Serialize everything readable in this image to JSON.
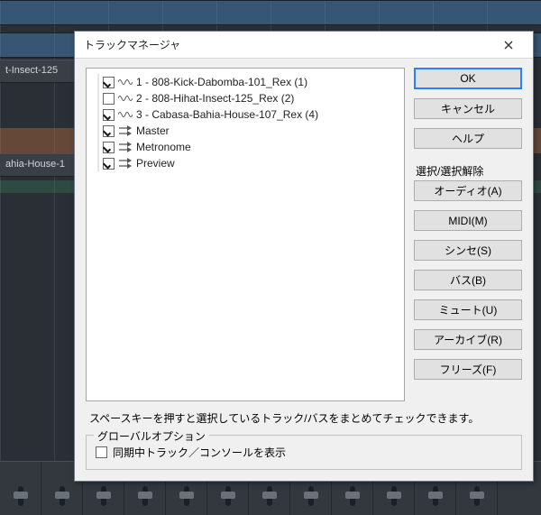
{
  "bg": {
    "track_labels": [
      "t-Insect-125",
      "ahia-House-1"
    ]
  },
  "dialog": {
    "title": "トラックマネージャ",
    "close_icon": "close-icon",
    "tree": {
      "items": [
        {
          "checked": true,
          "type": "audio",
          "label": "1 - 808-Kick-Dabomba-101_Rex (1)"
        },
        {
          "checked": false,
          "type": "audio",
          "label": "2 - 808-Hihat-Insect-125_Rex (2)"
        },
        {
          "checked": true,
          "type": "audio",
          "label": "3 - Cabasa-Bahia-House-107_Rex (4)"
        },
        {
          "checked": true,
          "type": "bus",
          "label": "Master"
        },
        {
          "checked": true,
          "type": "bus",
          "label": "Metronome"
        },
        {
          "checked": true,
          "type": "bus",
          "label": "Preview"
        }
      ]
    },
    "buttons": {
      "ok": "OK",
      "cancel": "キャンセル",
      "help": "ヘルプ"
    },
    "select_section_label": "選択/選択解除",
    "select_buttons": {
      "audio": "オーディオ(A)",
      "midi": "MIDI(M)",
      "synth": "シンセ(S)",
      "bus": "バス(B)",
      "mute": "ミュート(U)",
      "archive": "アーカイブ(R)",
      "freeze": "フリーズ(F)"
    },
    "footer_text": "スペースキーを押すと選択しているトラック/バスをまとめてチェックできます。",
    "global": {
      "legend": "グローバルオプション",
      "sync_label": "同期中トラック／コンソールを表示",
      "sync_checked": false
    }
  }
}
